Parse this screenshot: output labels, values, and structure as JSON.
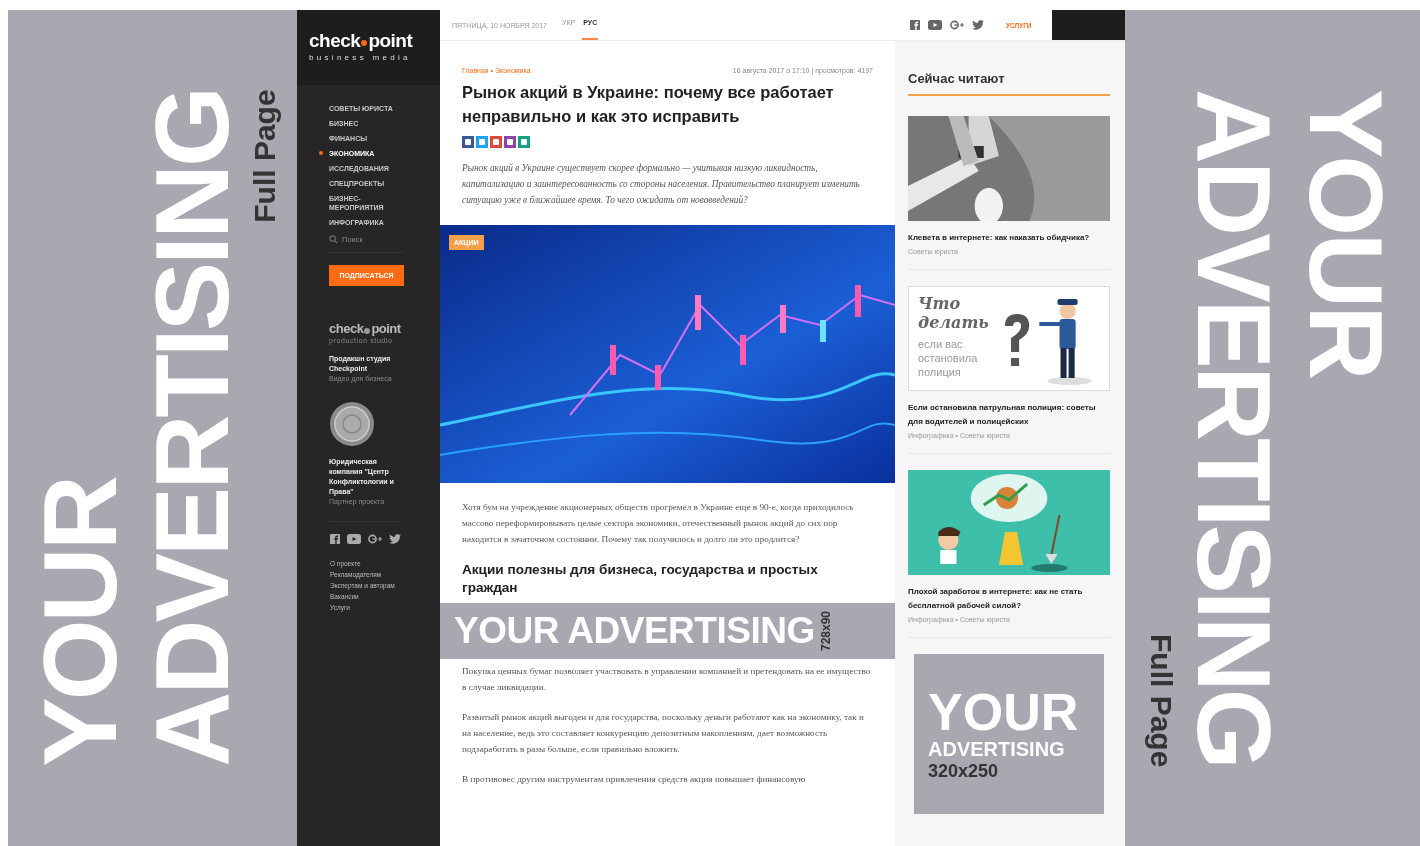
{
  "left_ad": {
    "lines": [
      "YOUR",
      "ADVERTISING"
    ],
    "caption": "Full Page"
  },
  "sidebar": {
    "logo": {
      "left": "check",
      "right": "point",
      "tagline": "business media"
    },
    "nav": [
      {
        "label": "СОВЕТЫ ЮРИСТА",
        "selected": false
      },
      {
        "label": "БИЗНЕС",
        "selected": false
      },
      {
        "label": "ФИНАНСЫ",
        "selected": false
      },
      {
        "label": "ЭКОНОМИКА",
        "selected": true
      },
      {
        "label": "ИССЛЕДОВАНИЯ",
        "selected": false
      },
      {
        "label": "СПЕЦПРОЕКТЫ",
        "selected": false
      },
      {
        "label": "БИЗНЕС-МЕРОПРИЯТИЯ",
        "selected": false
      },
      {
        "label": "ИНФОГРАФИКА",
        "selected": false
      }
    ],
    "search": {
      "placeholder": "Поиск"
    },
    "subscribe": "ПОДПИСАТЬСЯ",
    "studio": {
      "logo_left": "check",
      "logo_right": "point",
      "tagline": "production studio",
      "title": "Продакшн студия Checkpoint",
      "subtitle": "Видео для бизнеса"
    },
    "partner": {
      "title": "Юридическая компания \"Центр Конфликтологии и Права\"",
      "subtitle": "Партнер проекта"
    },
    "links": [
      "О проекте",
      "Рекламодателям",
      "Экспертам и авторам",
      "Вакансии",
      "Услуги"
    ]
  },
  "topbar": {
    "date": "ПЯТНИЦА, 10 НОЯБРЯ 2017",
    "languages": [
      {
        "label": "УКР",
        "selected": false
      },
      {
        "label": "РУС",
        "selected": true
      }
    ],
    "services": "УСЛУГИ"
  },
  "article": {
    "breadcrumbs": "Главная • Экономика",
    "meta": "16 августа 2017 о 17:10 | просмотров: 4197",
    "title": "Рынок акций в Украине: почему все работает неправильно и как это исправить",
    "share": [
      {
        "color": "#3b5998"
      },
      {
        "color": "#1da1f2"
      },
      {
        "color": "#dd4b39"
      },
      {
        "color": "#8e44ad"
      },
      {
        "color": "#16a085"
      }
    ],
    "lead": "Рынок акций в Украине существует скорее формально — учитывая низкую ликвидность, капитализацию и заинтересованность со стороны населения. Правительство планирует изменить ситуацию уже в ближайшее время. То чего ожидать от нововведений?",
    "image_tag": "АКЦИИ",
    "body": [
      {
        "kind": "p",
        "text": "Хотя бум на учреждение акционерных обществ прогремел в Украине еще в 90-е, когда приходилось массово переформировывать целые сектора экономики, отечественный рынок акций до сих пор находится в зачаточном состоянии. Почему так получилось и долго ли это продлится?"
      },
      {
        "kind": "h2",
        "text": "Акции полезны для бизнеса, государства и простых граждан"
      },
      {
        "kind": "ad",
        "text": "YOUR ADVERTISING",
        "size": "728x90"
      },
      {
        "kind": "p",
        "text": "Покупка ценных бумаг позволяет участвовать в управлении компанией и претендовать на ее имущество в случае ликвидации."
      },
      {
        "kind": "p",
        "text": "Развитый рынок акций выгоден и для государства, поскольку деньги работают как на экономику, так и на население, ведь это составляет конкуренцию депозитным накоплениям, дает возможность подзаработать в разы больше, если правильно вложить."
      },
      {
        "kind": "p",
        "text": "В противовес другим инструментам привлечения средств акция повышает финансовую"
      }
    ]
  },
  "reading": {
    "title": "Сейчас читают",
    "cards": [
      {
        "title": "Клевета в интернете: как наказать обидчика?",
        "meta": "Советы юриста"
      },
      {
        "title": "Если остановила патрульная полиция: советы для водителей и полицейских",
        "meta": "Инфографика • Советы юриста",
        "overlay": {
          "heading": "Что делать",
          "text": "если вас остановила полиция"
        }
      },
      {
        "title": "Плохой заработок в интернете: как не стать бесплатной рабочей силой?",
        "meta": "Инфографика • Советы юриста"
      }
    ],
    "ad": {
      "lines": [
        "YOUR",
        "ADVERTISING"
      ],
      "size": "320x250"
    }
  },
  "right_ad": {
    "lines": [
      "YOUR",
      "ADVERTISING"
    ],
    "caption": "Full Page"
  }
}
